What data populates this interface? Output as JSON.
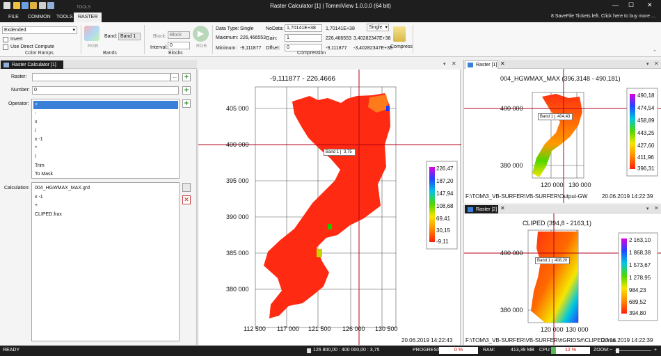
{
  "title_bar": {
    "title": "Raster Calculator [1] | TommiView 1.0.0.0 (64 bit)",
    "context_tab_label": "TOOLS",
    "minimize": "—",
    "maximize": "☐",
    "close": "✕"
  },
  "ribbon_tabs": [
    "FILE",
    "COMMON",
    "TOOLS",
    "RASTER"
  ],
  "ribbon_tabs_active_index": 3,
  "license_notice": "8 SaveFile Tickets left. Click here to buy more ...",
  "ribbon": {
    "color_ramp_value": "Exdended",
    "invert_label": "Invert",
    "direct_compute_label": "Use Direct Compute",
    "color_ramps_group": "Color Ramps",
    "rgb_label_1": "RGB",
    "band_label": "Band:",
    "band_value": "Band 1",
    "bands_group": "Bands",
    "block_label": "Block:",
    "block_value": "Block",
    "interval_label": "Interval:",
    "interval_value": "0",
    "rgb_label_2": "RGB",
    "blocks_group": "Blocks",
    "data_type_label": "Data Type:",
    "data_type_value": "Single",
    "maximum_label": "Maximum:",
    "maximum_value": "226,466553",
    "minimum_label": "Minimum:",
    "minimum_value": "-9,111877",
    "nodata_label": "NoData:",
    "nodata_value": "1,70141E+38",
    "nodata_value_2": "1,70141E+38",
    "gain_label": "Gain:",
    "gain_value": "1",
    "gain_value_2": "226,466553",
    "offset_label": "Offset:",
    "offset_value": "0",
    "offset_value_2": "-9,111877",
    "type_select": "Single",
    "max_type_value": "3,40282347E+38",
    "min_type_value": "-3,40282347E+38",
    "compression_group": "Compression",
    "compress_label": "Compress"
  },
  "calculator": {
    "tab_label": "Raster Calculator [1]",
    "raster_label": "Raster:",
    "raster_value": "",
    "browse_label": "...",
    "number_label": "Number:",
    "number_value": "0",
    "operator_label": "Operator:",
    "operators": [
      "+",
      "-",
      "x",
      "/",
      "x -1",
      "^",
      "\\",
      "Trim",
      "To Mask"
    ],
    "operators_selected": 0,
    "calculation_label": "Calculation:",
    "calculation_lines": [
      "004_HGWMAX_MAX.grd",
      "x -1",
      "+",
      "CLIPED.frax"
    ],
    "add_glyph": "+",
    "delete_glyph": "✕"
  },
  "main_map": {
    "range_title": "-9,111877 - 226,4666",
    "y_ticks": [
      "405 000",
      "400 000",
      "395 000",
      "390 000",
      "385 000",
      "380 000"
    ],
    "x_ticks": [
      "112 500",
      "117 000",
      "121 500",
      "126 000",
      "130 500"
    ],
    "tooltip_band": "Band 1",
    "tooltip_value": "3,75",
    "legend": [
      "226,47",
      "187,20",
      "147,94",
      "108,68",
      "69,41",
      "30,15",
      "-9,11"
    ],
    "timestamp": "20.06.2019 14:22:43"
  },
  "raster1": {
    "tab_label": "Raster [1]",
    "range_title": "004_HGWMAX_MAX (396,3148 - 490,181)",
    "y_ticks": [
      "400 000",
      "380 000"
    ],
    "x_ticks": [
      "120 000",
      "130 000"
    ],
    "tooltip_band": "Band 1",
    "tooltip_value": "404,43",
    "legend": [
      "490,18",
      "474,54",
      "458,89",
      "443,25",
      "427,60",
      "411,96",
      "396,31"
    ],
    "path": "F:\\TOM\\3_VB-SURFER\\VB-SURFER\\Output-GW",
    "timestamp": "20.06.2019 14:22:39"
  },
  "raster2": {
    "tab_label": "Raster [2]",
    "range_title": "CLIPED (394,8 - 2163,1)",
    "y_ticks": [
      "400 000",
      "380 000"
    ],
    "x_ticks": [
      "120 000",
      "130 000"
    ],
    "tooltip_band": "Band 1",
    "tooltip_value": "408,20",
    "legend": [
      "2 163,10",
      "1 868,38",
      "1 573,67",
      "1 278,95",
      "984,23",
      "689,52",
      "394,80"
    ],
    "path": "F:\\TOM\\3_VB-SURFER\\VB-SURFER\\#GRIDS#\\CLIPED.frax",
    "timestamp": "20.06.2019 14:22:39"
  },
  "status_bar": {
    "ready": "READY",
    "coords": "126 800,00 : 400 000,00 : 3,75",
    "progress_label": "PROGRESS:",
    "progress_value": "0 %",
    "progress_fraction": 0,
    "ram_label": "RAM:",
    "ram_value": "413,39 MB",
    "cpu_label": "CPU:",
    "cpu_value": "12 %",
    "cpu_fraction": 0.12,
    "zoom_label": "ZOOM:",
    "zoom_minus": "−",
    "zoom_plus": "+"
  },
  "colors": {
    "accent": "#3a7fd8",
    "title_bg": "#1e1e1e",
    "crosshair": "#b3001b"
  }
}
